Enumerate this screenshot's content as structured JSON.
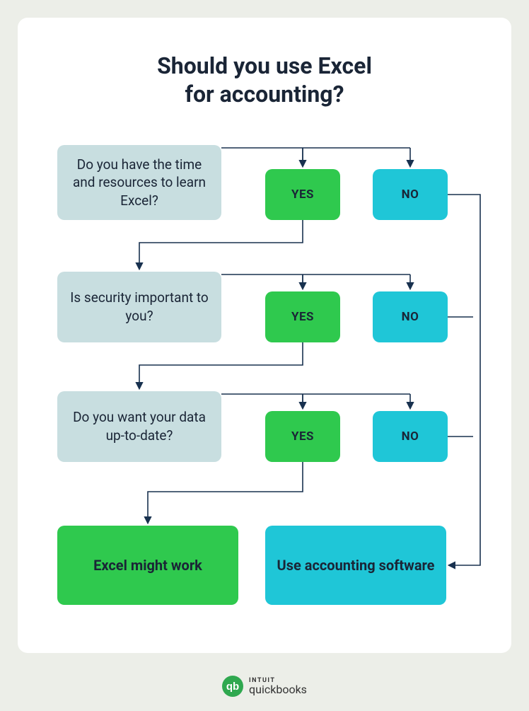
{
  "title_line1": "Should you use Excel",
  "title_line2": "for accounting?",
  "questions": {
    "q1": "Do you have the time and resources to learn Excel?",
    "q2": "Is security important to you?",
    "q3": "Do you want your data up-to-date?"
  },
  "answers": {
    "yes": "YES",
    "no": "NO"
  },
  "results": {
    "excel": "Excel might work",
    "software": "Use accounting software"
  },
  "branding": {
    "top": "INTUIT",
    "bottom": "quickbooks",
    "icon_label": "qb"
  },
  "colors": {
    "page_bg": "#eceee8",
    "card_bg": "#ffffff",
    "question_bg": "#c8dee0",
    "yes_bg": "#2fc94e",
    "no_bg": "#1fc6d7",
    "connector": "#18314f",
    "text": "#1a2536"
  },
  "chart_data": {
    "type": "table",
    "description": "Decision flowchart with three yes/no questions leading to two outcomes.",
    "nodes": [
      {
        "id": "q1",
        "kind": "question",
        "text": "Do you have the time and resources to learn Excel?"
      },
      {
        "id": "q1_yes",
        "kind": "answer",
        "text": "YES"
      },
      {
        "id": "q1_no",
        "kind": "answer",
        "text": "NO"
      },
      {
        "id": "q2",
        "kind": "question",
        "text": "Is security important to you?"
      },
      {
        "id": "q2_yes",
        "kind": "answer",
        "text": "YES"
      },
      {
        "id": "q2_no",
        "kind": "answer",
        "text": "NO"
      },
      {
        "id": "q3",
        "kind": "question",
        "text": "Do you want your data up-to-date?"
      },
      {
        "id": "q3_yes",
        "kind": "answer",
        "text": "YES"
      },
      {
        "id": "q3_no",
        "kind": "answer",
        "text": "NO"
      },
      {
        "id": "r_excel",
        "kind": "result",
        "text": "Excel might work"
      },
      {
        "id": "r_software",
        "kind": "result",
        "text": "Use accounting software"
      }
    ],
    "edges": [
      {
        "from": "q1",
        "to": "q1_yes"
      },
      {
        "from": "q1",
        "to": "q1_no"
      },
      {
        "from": "q1_yes",
        "to": "q2"
      },
      {
        "from": "q1_no",
        "to": "r_software"
      },
      {
        "from": "q2",
        "to": "q2_yes"
      },
      {
        "from": "q2",
        "to": "q2_no"
      },
      {
        "from": "q2_yes",
        "to": "q3"
      },
      {
        "from": "q2_no",
        "to": "r_software"
      },
      {
        "from": "q3",
        "to": "q3_yes"
      },
      {
        "from": "q3",
        "to": "q3_no"
      },
      {
        "from": "q3_yes",
        "to": "r_excel"
      },
      {
        "from": "q3_no",
        "to": "r_software"
      }
    ]
  }
}
